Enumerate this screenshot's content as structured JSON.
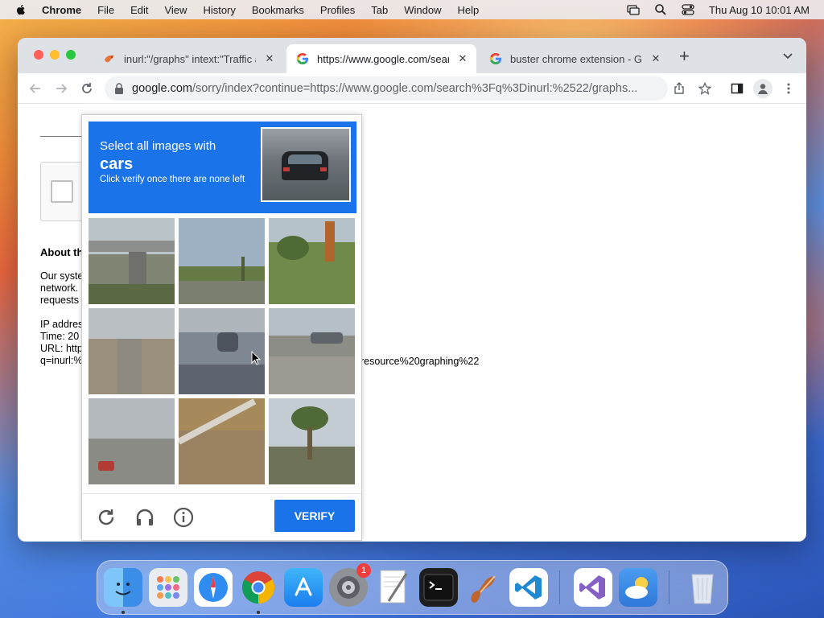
{
  "menubar": {
    "app_name": "Chrome",
    "items": [
      "File",
      "Edit",
      "View",
      "History",
      "Bookmarks",
      "Profiles",
      "Tab",
      "Window",
      "Help"
    ],
    "clock": "Thu Aug 10  10:01 AM"
  },
  "browser": {
    "tabs": [
      {
        "title": "inurl:\"/graphs\" intext:\"Traffic a",
        "active": false
      },
      {
        "title": "https://www.google.com/searc",
        "active": true
      },
      {
        "title": "buster chrome extension - Goo",
        "active": false
      }
    ],
    "new_tab": "+",
    "url_host": "google.com",
    "url_rest": "/sorry/index?continue=https://www.google.com/search%3Fq%3Dinurl:%2522/graphs..."
  },
  "page": {
    "about_heading": "About th",
    "para1": [
      "Our syste",
      "network.",
      "requests"
    ],
    "para2": [
      "IP addres",
      "Time: 20",
      "URL: http",
      "q=inurl:%"
    ],
    "url_tail": "resource%20graphing%22"
  },
  "captcha": {
    "instruction_line1": "Select all images with",
    "target_object": "cars",
    "instruction_line3": "Click verify once there are none left",
    "verify_label": "VERIFY",
    "tiles": [
      {
        "scene": "overpass"
      },
      {
        "scene": "palm-road"
      },
      {
        "scene": "trees"
      },
      {
        "scene": "road"
      },
      {
        "scene": "street-car"
      },
      {
        "scene": "parking"
      },
      {
        "scene": "highway-car"
      },
      {
        "scene": "guardrail"
      },
      {
        "scene": "palm-tree"
      }
    ],
    "footer_icons": [
      "reload-icon",
      "audio-icon",
      "info-icon"
    ]
  },
  "dock": {
    "apps": [
      "Finder",
      "Launchpad",
      "Safari",
      "Chrome",
      "App Store",
      "System Settings",
      "TextEdit",
      "Terminal",
      "GarageBand",
      "VS Code",
      "Visual Studio",
      "Weather",
      "Trash"
    ],
    "settings_badge": "1"
  },
  "colors": {
    "captcha_blue": "#1a73e8",
    "tab_strip": "#dee1e6"
  }
}
